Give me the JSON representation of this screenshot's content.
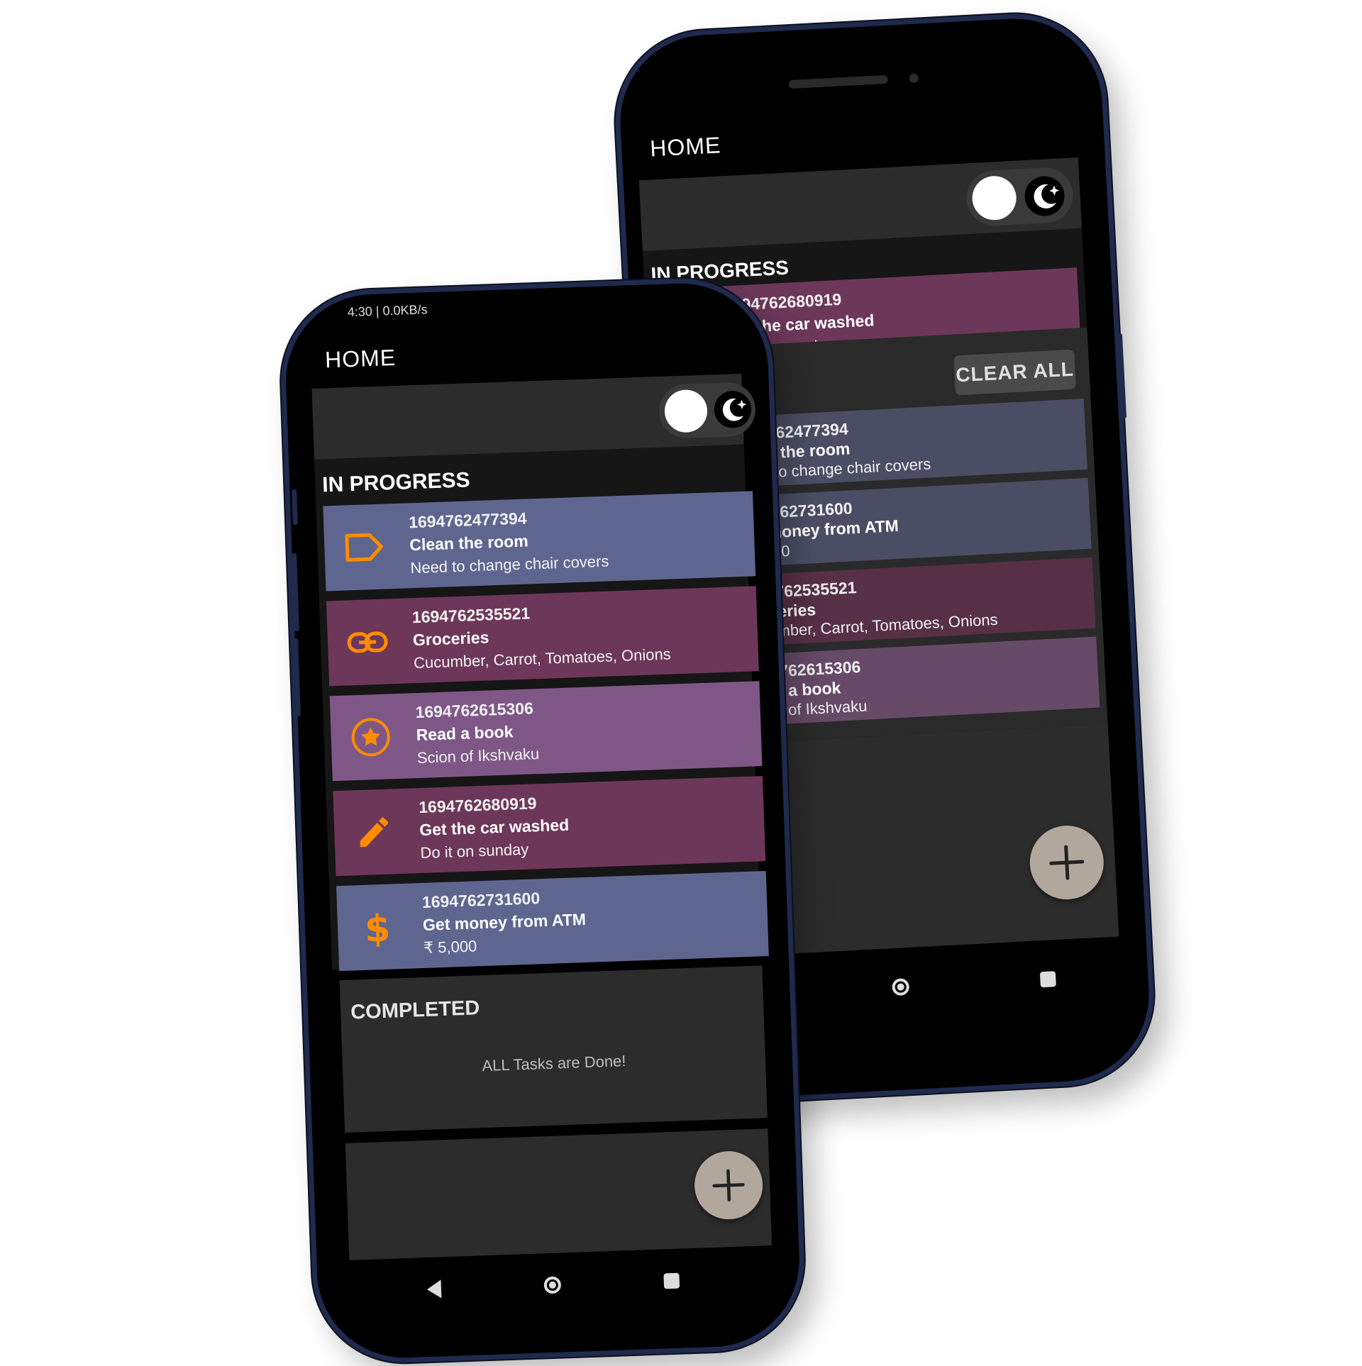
{
  "phones": {
    "front": {
      "status_text": "4:30 | 0.0KB/s",
      "title": "HOME",
      "in_progress_label": "IN PROGRESS",
      "tasks": [
        {
          "id": "1694762477394",
          "title": "Clean the room",
          "desc": "Need to change chair covers",
          "icon": "tag-icon",
          "color": "#5e6690"
        },
        {
          "id": "1694762535521",
          "title": "Groceries",
          "desc": "Cucumber, Carrot, Tomatoes, Onions",
          "icon": "link-icon",
          "color": "#6d3759"
        },
        {
          "id": "1694762615306",
          "title": "Read a book",
          "desc": "Scion of Ikshvaku",
          "icon": "star-circle-icon",
          "color": "#7e5787"
        },
        {
          "id": "1694762680919",
          "title": "Get the car washed",
          "desc": "Do it on sunday",
          "icon": "pencil-icon",
          "color": "#6d3759"
        },
        {
          "id": "1694762731600",
          "title": "Get money from ATM",
          "desc": "₹ 5,000",
          "icon": "dollar-icon",
          "color": "#5e6690"
        }
      ],
      "completed_label": "COMPLETED",
      "empty_text": "ALL Tasks are Done!"
    },
    "back": {
      "title": "HOME",
      "in_progress_label": "IN PROGRESS",
      "dragging_task": {
        "id": "1694762680919",
        "title": "Get the car washed",
        "desc": "Do it on sunday"
      },
      "clear_all_label": "CLEAR ALL",
      "completed_tasks": [
        {
          "id": "1694762477394",
          "title": "Clean the room",
          "desc": "Need to change chair covers",
          "color": "#4a4d63"
        },
        {
          "id": "1694762731600",
          "title": "Get money from ATM",
          "desc": "₹ 5,000",
          "color": "#4a4d63"
        },
        {
          "id": "1694762535521",
          "title": "Groceries",
          "desc": "Cucumber, Carrot, Tomatoes, Onions",
          "color": "#573046"
        },
        {
          "id": "1694762615306",
          "title": "Read a book",
          "desc": "Scion of Ikshvaku",
          "color": "#664a68"
        }
      ]
    }
  },
  "colors": {
    "accent_icon": "#ff8c00",
    "fab": "#b1a79d",
    "frame": "#1f2a4d"
  }
}
